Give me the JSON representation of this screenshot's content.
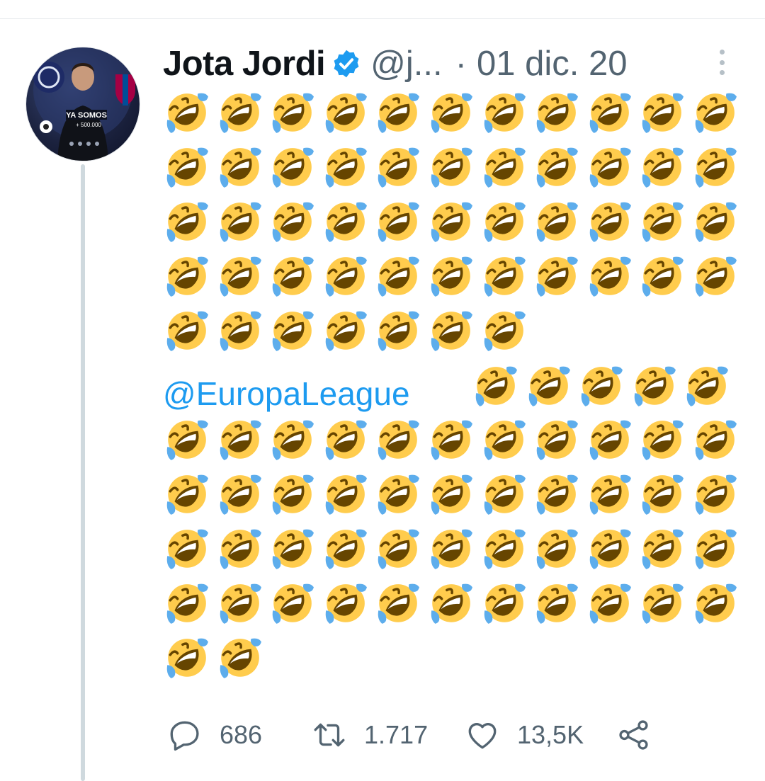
{
  "tweet": {
    "author_name": "Jota Jordi",
    "handle": "@j...",
    "separator": "·",
    "date": "01 dic. 20",
    "mention": "@EuropaLeague",
    "emoji_char": "🤣",
    "emoji_rows_before_mention": [
      11,
      11,
      11,
      11,
      7
    ],
    "emoji_after_mention_inline": 5,
    "emoji_rows_after_mention": [
      11,
      11,
      11,
      11,
      2
    ]
  },
  "avatar": {
    "banner_text": "YA SOMOS",
    "banner_subtext": "+ 500.000"
  },
  "actions": {
    "replies": "686",
    "retweets": "1.717",
    "likes": "13,5K"
  },
  "colors": {
    "accent": "#1d9bf0",
    "text": "#0f1419",
    "muted": "#536471",
    "thread_line": "#cfd9de"
  }
}
